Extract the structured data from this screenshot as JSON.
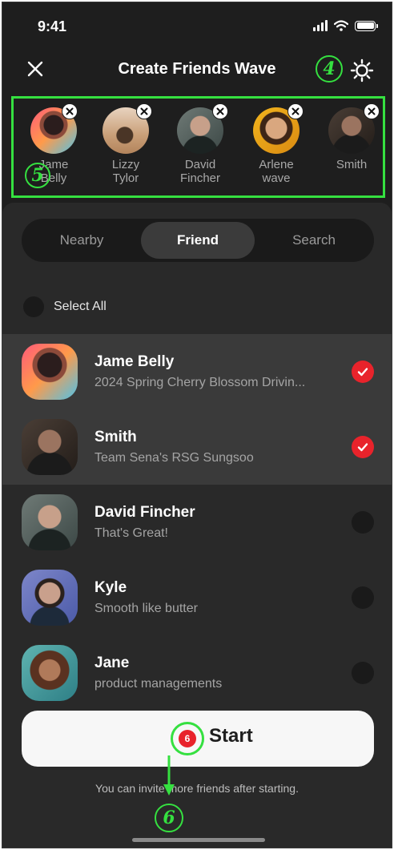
{
  "status": {
    "time": "9:41"
  },
  "header": {
    "title": "Create Friends Wave"
  },
  "annotations": {
    "settings": "4",
    "strip": "5",
    "start": "6"
  },
  "selected": [
    {
      "line1": "Jame",
      "line2": "Belly"
    },
    {
      "line1": "Lizzy",
      "line2": "Tylor"
    },
    {
      "line1": "David",
      "line2": "Fincher"
    },
    {
      "line1": "Arlene",
      "line2": "wave"
    },
    {
      "line1": "Smith",
      "line2": ""
    }
  ],
  "tabs": [
    "Nearby",
    "Friend",
    "Search"
  ],
  "active_tab": "Friend",
  "select_all_label": "Select All",
  "friends": [
    {
      "name": "Jame Belly",
      "subtitle": "2024 Spring Cherry Blossom Drivin...",
      "checked": true
    },
    {
      "name": "Smith",
      "subtitle": "Team Sena's RSG Sungsoo",
      "checked": true
    },
    {
      "name": "David Fincher",
      "subtitle": "That's Great!",
      "checked": false
    },
    {
      "name": "Kyle",
      "subtitle": "Smooth like butter",
      "checked": false
    },
    {
      "name": "Jane",
      "subtitle": "product managements",
      "checked": false
    }
  ],
  "start": {
    "label": "Start",
    "badge": "6"
  },
  "invite_note": "You can invite more friends after starting.",
  "colors": {
    "background": "#1e1e1e",
    "panel": "#292929",
    "accent_red": "#e8232b",
    "annotation_green": "#35e040"
  }
}
